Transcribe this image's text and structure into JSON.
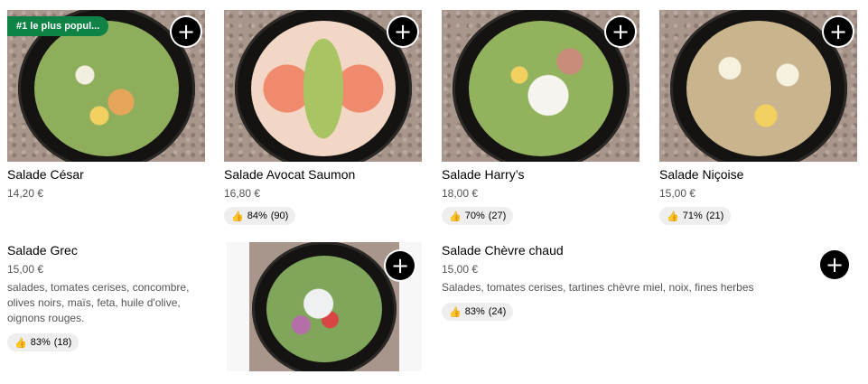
{
  "currency_note": "",
  "items": [
    {
      "name": "Salade César",
      "price": "14,20 €",
      "badge": "#1 le plus popul...",
      "add_icon": "plus-icon",
      "food_color": "#d9c28a"
    },
    {
      "name": "Salade Avocat Saumon",
      "price": "16,80 €",
      "rating_pct": "84%",
      "rating_count": "(90)",
      "add_icon": "plus-icon",
      "food_color": "#e58f72"
    },
    {
      "name": "Salade Harry’s",
      "price": "18,00 €",
      "rating_pct": "70%",
      "rating_count": "(27)",
      "add_icon": "plus-icon",
      "food_color": "#d8c47a"
    },
    {
      "name": "Salade Niçoise",
      "price": "15,00 €",
      "rating_pct": "71%",
      "rating_count": "(21)",
      "add_icon": "plus-icon",
      "food_color": "#e3cf7e"
    },
    {
      "name": "Salade Grec",
      "price": "15,00 €",
      "description": "salades, tomates cerises, concombre, olives noirs, maïs, feta, huile d'olive, oignons rouges.",
      "rating_pct": "83%",
      "rating_count": "(18)",
      "food_color": "#7fa65a"
    },
    {
      "name": "Salade Chèvre chaud",
      "price": "15,00 €",
      "description": "Salades, tomates cerises, tartines chèvre miel, noix, fines herbes",
      "rating_pct": "83%",
      "rating_count": "(24)",
      "add_icon": "plus-icon"
    }
  ],
  "icons": {
    "add": "+",
    "thumb": "👍"
  }
}
